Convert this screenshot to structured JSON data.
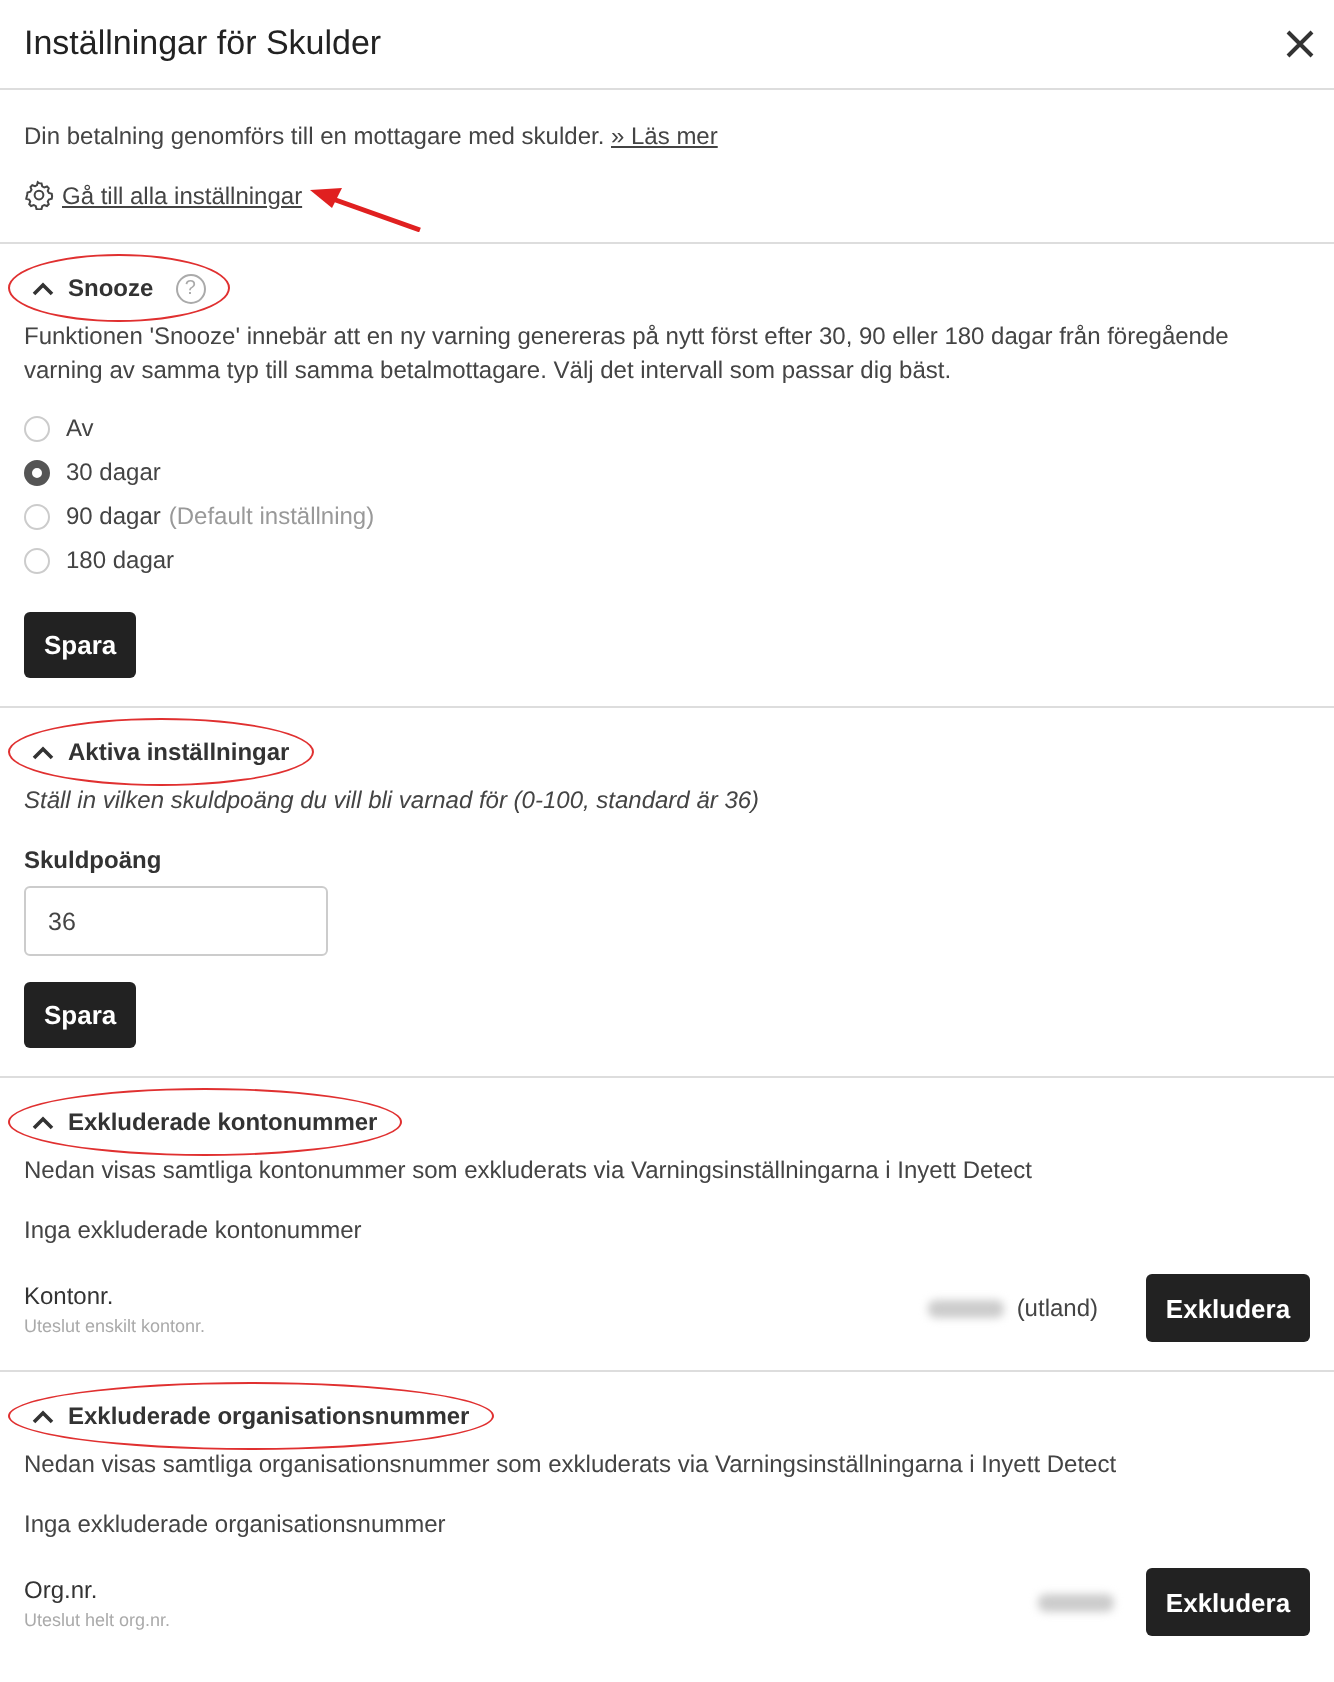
{
  "title": "Inställningar för Skulder",
  "intro": {
    "text": "Din betalning genomförs till en mottagare med skulder.",
    "link": "» Läs mer"
  },
  "settings_link": {
    "label": "Gå till alla inställningar",
    "annotated": true
  },
  "sections": [
    {
      "kind": "radio",
      "title": "Snooze",
      "help": "?",
      "expanded": true,
      "annotated": true,
      "description": "Funktionen 'Snooze' innebär att en ny varning genereras på nytt först efter 30, 90 eller 180 dagar från föregående varning av samma typ till samma betalmottagare. Välj det intervall som passar dig bäst.",
      "options": [
        {
          "label": "Av",
          "selected": false
        },
        {
          "label": "30 dagar",
          "selected": true
        },
        {
          "label": "90 dagar",
          "note": "(Default inställning)",
          "selected": false
        },
        {
          "label": "180 dagar",
          "selected": false
        }
      ],
      "button": "Spara"
    },
    {
      "kind": "score",
      "title": "Aktiva inställningar",
      "expanded": true,
      "annotated": true,
      "hint": "Ställ in vilken skuldpoäng du vill bli varnad för (0-100, standard är 36)",
      "field_label": "Skuldpoäng",
      "value": "36",
      "button": "Spara"
    },
    {
      "kind": "exclude",
      "title": "Exkluderade kontonummer",
      "expanded": true,
      "annotated": true,
      "description": "Nedan visas samtliga kontonummer som exkluderats via Varningsinställningarna i Inyett Detect",
      "empty": "Inga exkluderade kontonummer",
      "label": "Kontonr.",
      "sublabel": "Uteslut enskilt kontonr.",
      "suffix": "(utland)",
      "button": "Exkludera"
    },
    {
      "kind": "exclude",
      "title": "Exkluderade organisationsnummer",
      "expanded": true,
      "annotated": true,
      "description": "Nedan visas samtliga organisationsnummer som exkluderats via Varningsinställningarna i Inyett Detect",
      "empty": "Inga exkluderade organisationsnummer",
      "label": "Org.nr.",
      "sublabel": "Uteslut helt org.nr.",
      "button": "Exkludera"
    }
  ]
}
